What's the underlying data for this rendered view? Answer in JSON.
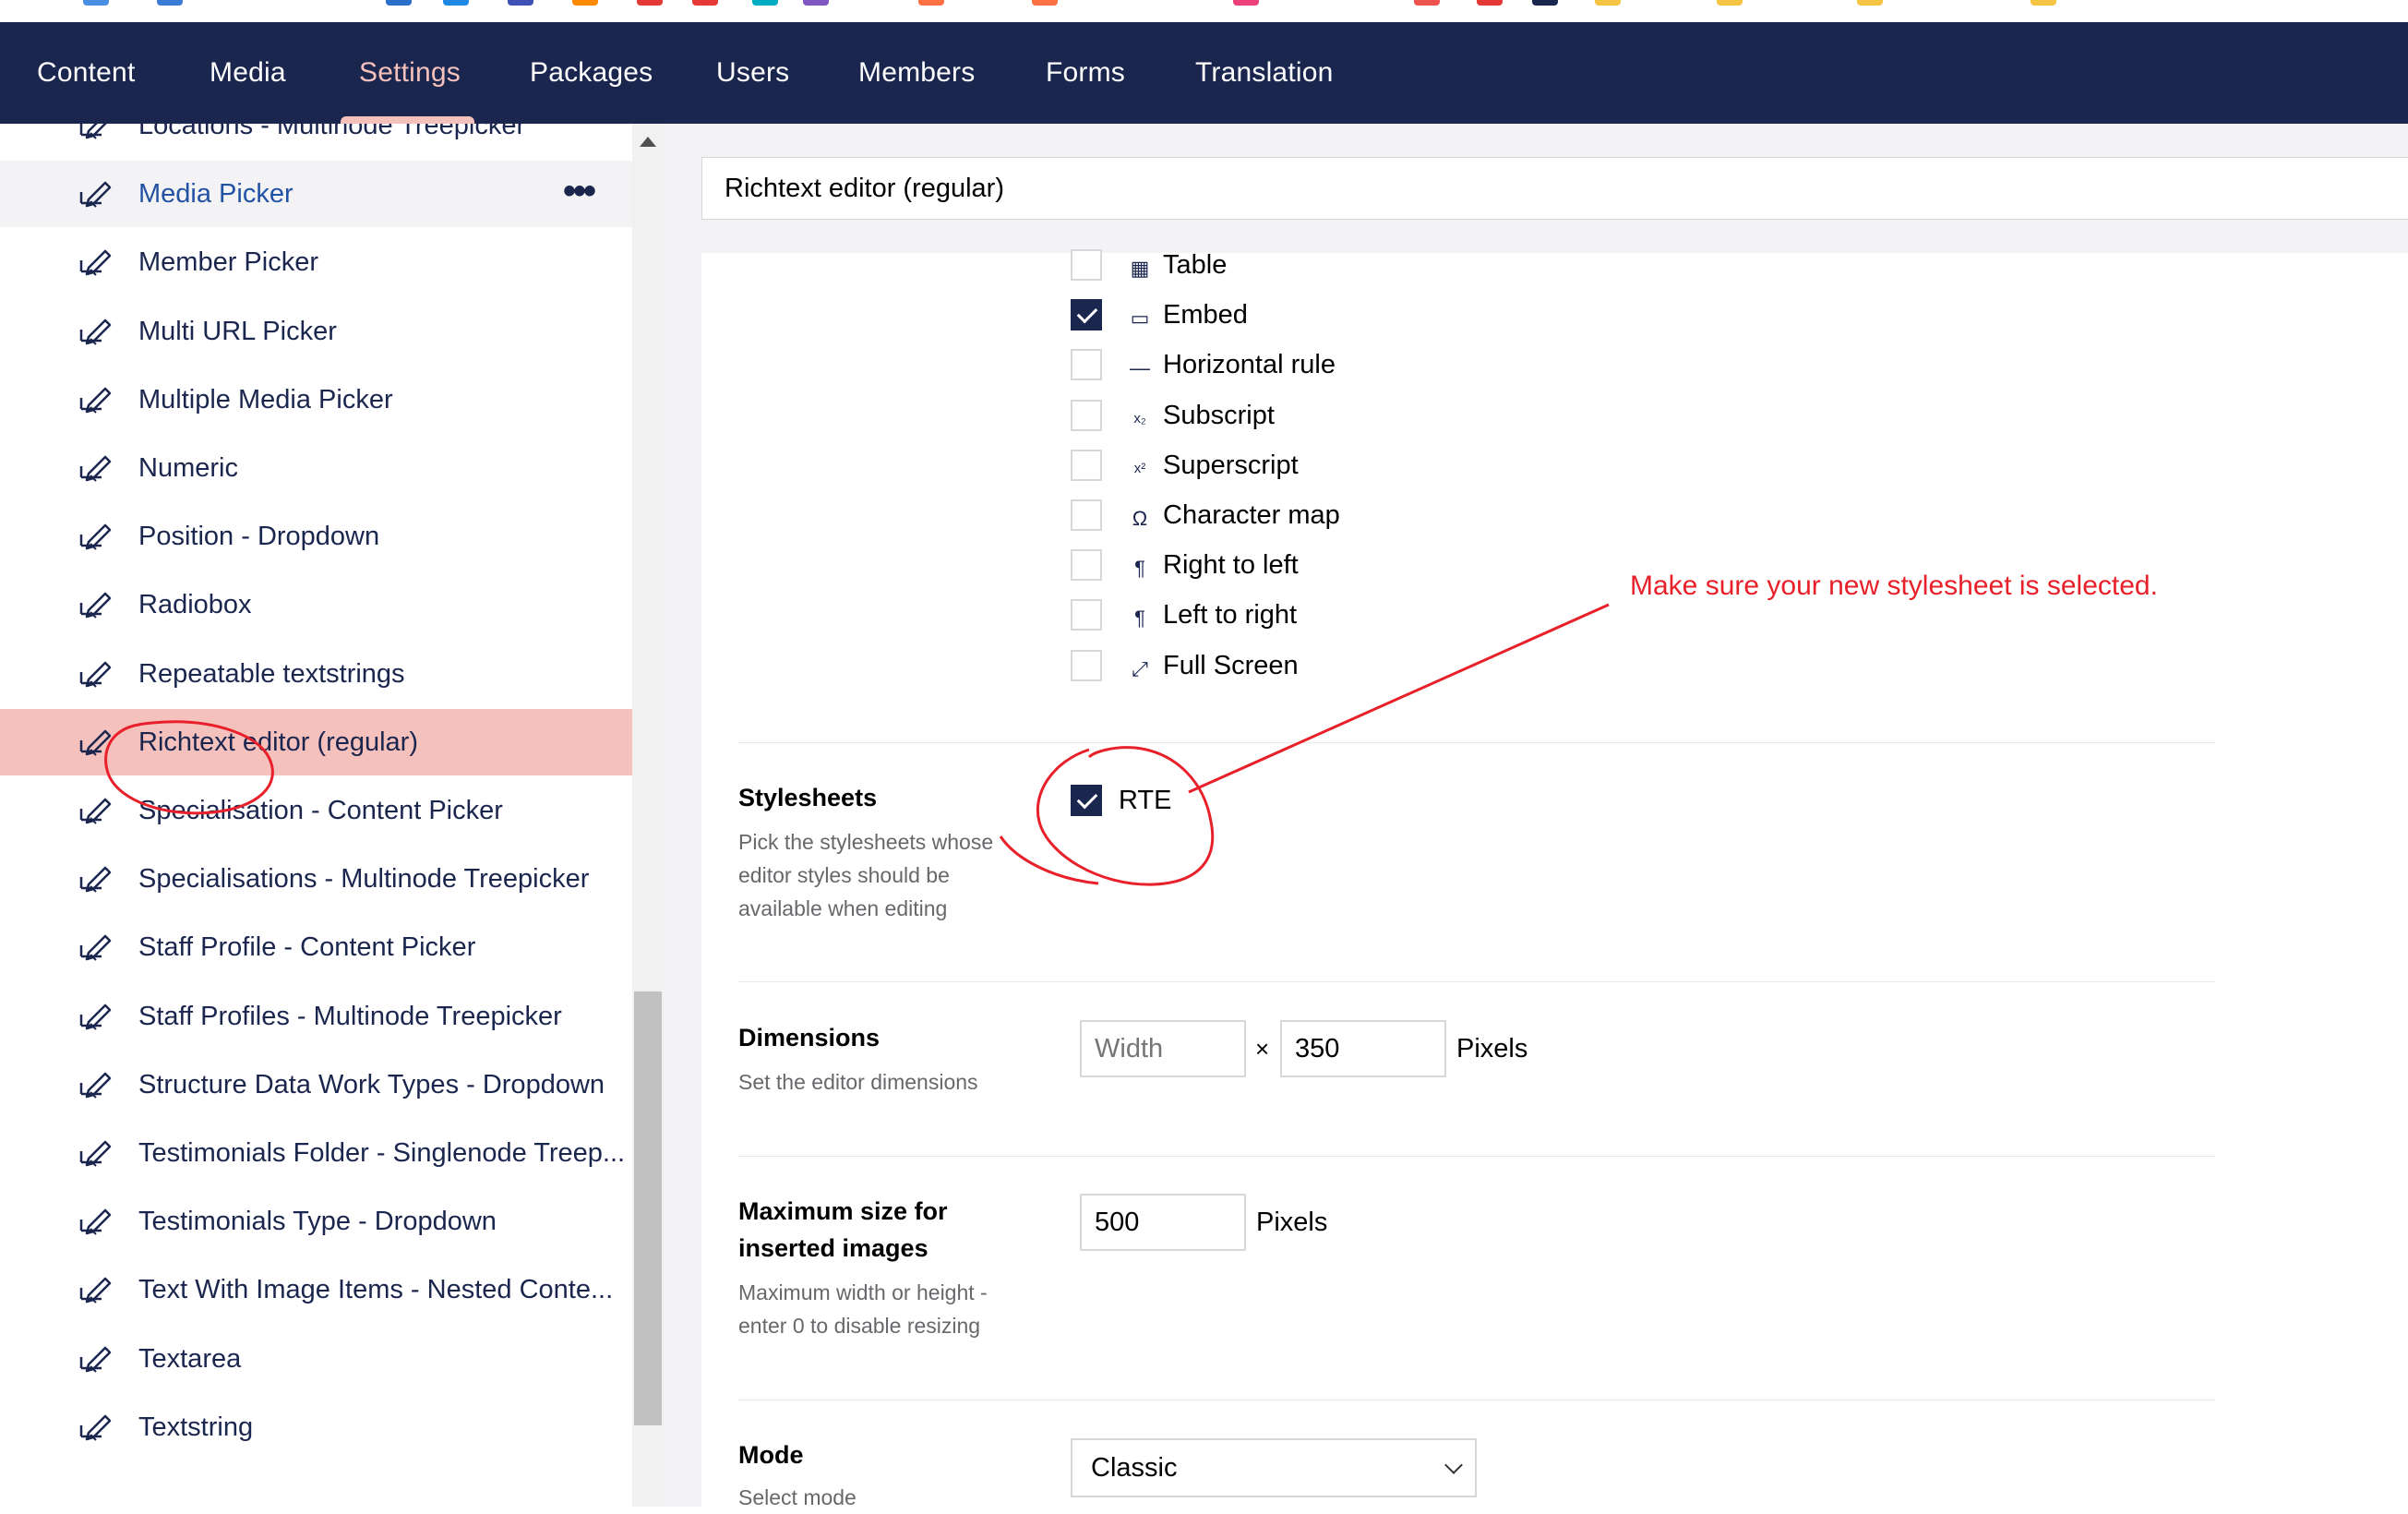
{
  "nav": {
    "items": [
      "Content",
      "Media",
      "Settings",
      "Packages",
      "Users",
      "Members",
      "Forms",
      "Translation"
    ],
    "active": "Settings"
  },
  "tree": {
    "items": [
      "Locations - Multinode Treepicker",
      "Media Picker",
      "Member Picker",
      "Multi URL Picker",
      "Multiple Media Picker",
      "Numeric",
      "Position - Dropdown",
      "Radiobox",
      "Repeatable textstrings",
      "Richtext editor (regular)",
      "Specialisation - Content Picker",
      "Specialisations - Multinode Treepicker",
      "Staff Profile - Content Picker",
      "Staff Profiles - Multinode Treepicker",
      "Structure Data Work Types - Dropdown",
      "Testimonials Folder - Singlenode Treep...",
      "Testimonials Type - Dropdown",
      "Text With Image Items - Nested Conte...",
      "Textarea",
      "Textstring"
    ],
    "hover_item": "Media Picker",
    "selected_item": "Richtext editor (regular)",
    "more_label": "•••",
    "item_icon": "edit-datatype-icon"
  },
  "header": {
    "title": "Richtext editor (regular)"
  },
  "toolbar_options": [
    {
      "icon": "table-icon",
      "glyph": "▦",
      "label": "Table",
      "checked": false
    },
    {
      "icon": "embed-icon",
      "glyph": "▭",
      "label": "Embed",
      "checked": true
    },
    {
      "icon": "horizontal-rule-icon",
      "glyph": "—",
      "label": "Horizontal rule",
      "checked": false
    },
    {
      "icon": "subscript-icon",
      "glyph": "x₂",
      "label": "Subscript",
      "checked": false
    },
    {
      "icon": "superscript-icon",
      "glyph": "x²",
      "label": "Superscript",
      "checked": false
    },
    {
      "icon": "character-map-icon",
      "glyph": "Ω",
      "label": "Character map",
      "checked": false
    },
    {
      "icon": "right-to-left-icon",
      "glyph": "¶",
      "label": "Right to left",
      "checked": false
    },
    {
      "icon": "left-to-right-icon",
      "glyph": "¶",
      "label": "Left to right",
      "checked": false
    },
    {
      "icon": "full-screen-icon",
      "glyph": "⤢",
      "label": "Full Screen",
      "checked": false
    }
  ],
  "stylesheets": {
    "label": "Stylesheets",
    "description_lines": [
      "Pick the stylesheets whose",
      "editor styles should be",
      "available when editing"
    ],
    "option_label": "RTE",
    "option_checked": true
  },
  "dimensions": {
    "label": "Dimensions",
    "description": "Set the editor dimensions",
    "width_placeholder": "Width",
    "width_value": "",
    "separator": "×",
    "height_value": "350",
    "unit": "Pixels"
  },
  "max_image_size": {
    "label_lines": [
      "Maximum size for",
      "inserted images"
    ],
    "description_lines": [
      "Maximum width or height -",
      "enter 0 to disable resizing"
    ],
    "value": "500",
    "unit": "Pixels"
  },
  "mode": {
    "label": "Mode",
    "description": "Select mode",
    "selected": "Classic"
  },
  "annotation": {
    "text": "Make sure your new stylesheet is selected.",
    "color": "#e8202a"
  },
  "colors": {
    "nav_bg": "#1b264f",
    "nav_active": "#f5c1bc",
    "selected_row": "#f5c1bc",
    "annotation": "#e8202a"
  }
}
